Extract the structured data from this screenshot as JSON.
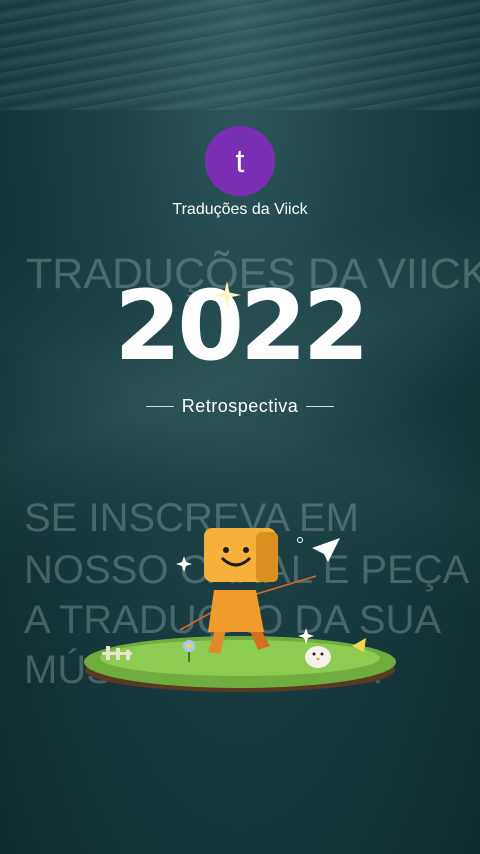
{
  "channel": {
    "avatar_letter": "t",
    "name": "Traduções da Viick",
    "avatar_color": "#7b2fb5"
  },
  "overlay": {
    "title": "TRADUÇÕES DA VIICK",
    "lines": [
      "SE INSCREVA EM",
      "NOSSO CANAL E PEÇA",
      "A TRADUÇÃO DA SUA",
      "MÚSICA FAVORITA"
    ]
  },
  "recap": {
    "year": "2022",
    "label": "Retrospectiva"
  },
  "icons": {
    "sparkle": "sparkle-icon",
    "paper_plane": "paper-plane-icon",
    "mascot": "mascot-icon"
  }
}
